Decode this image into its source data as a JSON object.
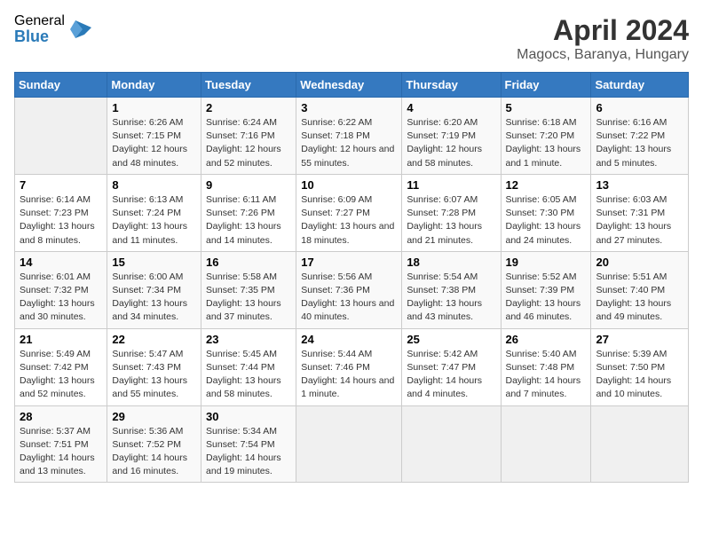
{
  "header": {
    "logo_general": "General",
    "logo_blue": "Blue",
    "month_year": "April 2024",
    "location": "Magocs, Baranya, Hungary"
  },
  "days_of_week": [
    "Sunday",
    "Monday",
    "Tuesday",
    "Wednesday",
    "Thursday",
    "Friday",
    "Saturday"
  ],
  "weeks": [
    [
      {
        "day": "",
        "sunrise": "",
        "sunset": "",
        "daylight": ""
      },
      {
        "day": "1",
        "sunrise": "Sunrise: 6:26 AM",
        "sunset": "Sunset: 7:15 PM",
        "daylight": "Daylight: 12 hours and 48 minutes."
      },
      {
        "day": "2",
        "sunrise": "Sunrise: 6:24 AM",
        "sunset": "Sunset: 7:16 PM",
        "daylight": "Daylight: 12 hours and 52 minutes."
      },
      {
        "day": "3",
        "sunrise": "Sunrise: 6:22 AM",
        "sunset": "Sunset: 7:18 PM",
        "daylight": "Daylight: 12 hours and 55 minutes."
      },
      {
        "day": "4",
        "sunrise": "Sunrise: 6:20 AM",
        "sunset": "Sunset: 7:19 PM",
        "daylight": "Daylight: 12 hours and 58 minutes."
      },
      {
        "day": "5",
        "sunrise": "Sunrise: 6:18 AM",
        "sunset": "Sunset: 7:20 PM",
        "daylight": "Daylight: 13 hours and 1 minute."
      },
      {
        "day": "6",
        "sunrise": "Sunrise: 6:16 AM",
        "sunset": "Sunset: 7:22 PM",
        "daylight": "Daylight: 13 hours and 5 minutes."
      }
    ],
    [
      {
        "day": "7",
        "sunrise": "Sunrise: 6:14 AM",
        "sunset": "Sunset: 7:23 PM",
        "daylight": "Daylight: 13 hours and 8 minutes."
      },
      {
        "day": "8",
        "sunrise": "Sunrise: 6:13 AM",
        "sunset": "Sunset: 7:24 PM",
        "daylight": "Daylight: 13 hours and 11 minutes."
      },
      {
        "day": "9",
        "sunrise": "Sunrise: 6:11 AM",
        "sunset": "Sunset: 7:26 PM",
        "daylight": "Daylight: 13 hours and 14 minutes."
      },
      {
        "day": "10",
        "sunrise": "Sunrise: 6:09 AM",
        "sunset": "Sunset: 7:27 PM",
        "daylight": "Daylight: 13 hours and 18 minutes."
      },
      {
        "day": "11",
        "sunrise": "Sunrise: 6:07 AM",
        "sunset": "Sunset: 7:28 PM",
        "daylight": "Daylight: 13 hours and 21 minutes."
      },
      {
        "day": "12",
        "sunrise": "Sunrise: 6:05 AM",
        "sunset": "Sunset: 7:30 PM",
        "daylight": "Daylight: 13 hours and 24 minutes."
      },
      {
        "day": "13",
        "sunrise": "Sunrise: 6:03 AM",
        "sunset": "Sunset: 7:31 PM",
        "daylight": "Daylight: 13 hours and 27 minutes."
      }
    ],
    [
      {
        "day": "14",
        "sunrise": "Sunrise: 6:01 AM",
        "sunset": "Sunset: 7:32 PM",
        "daylight": "Daylight: 13 hours and 30 minutes."
      },
      {
        "day": "15",
        "sunrise": "Sunrise: 6:00 AM",
        "sunset": "Sunset: 7:34 PM",
        "daylight": "Daylight: 13 hours and 34 minutes."
      },
      {
        "day": "16",
        "sunrise": "Sunrise: 5:58 AM",
        "sunset": "Sunset: 7:35 PM",
        "daylight": "Daylight: 13 hours and 37 minutes."
      },
      {
        "day": "17",
        "sunrise": "Sunrise: 5:56 AM",
        "sunset": "Sunset: 7:36 PM",
        "daylight": "Daylight: 13 hours and 40 minutes."
      },
      {
        "day": "18",
        "sunrise": "Sunrise: 5:54 AM",
        "sunset": "Sunset: 7:38 PM",
        "daylight": "Daylight: 13 hours and 43 minutes."
      },
      {
        "day": "19",
        "sunrise": "Sunrise: 5:52 AM",
        "sunset": "Sunset: 7:39 PM",
        "daylight": "Daylight: 13 hours and 46 minutes."
      },
      {
        "day": "20",
        "sunrise": "Sunrise: 5:51 AM",
        "sunset": "Sunset: 7:40 PM",
        "daylight": "Daylight: 13 hours and 49 minutes."
      }
    ],
    [
      {
        "day": "21",
        "sunrise": "Sunrise: 5:49 AM",
        "sunset": "Sunset: 7:42 PM",
        "daylight": "Daylight: 13 hours and 52 minutes."
      },
      {
        "day": "22",
        "sunrise": "Sunrise: 5:47 AM",
        "sunset": "Sunset: 7:43 PM",
        "daylight": "Daylight: 13 hours and 55 minutes."
      },
      {
        "day": "23",
        "sunrise": "Sunrise: 5:45 AM",
        "sunset": "Sunset: 7:44 PM",
        "daylight": "Daylight: 13 hours and 58 minutes."
      },
      {
        "day": "24",
        "sunrise": "Sunrise: 5:44 AM",
        "sunset": "Sunset: 7:46 PM",
        "daylight": "Daylight: 14 hours and 1 minute."
      },
      {
        "day": "25",
        "sunrise": "Sunrise: 5:42 AM",
        "sunset": "Sunset: 7:47 PM",
        "daylight": "Daylight: 14 hours and 4 minutes."
      },
      {
        "day": "26",
        "sunrise": "Sunrise: 5:40 AM",
        "sunset": "Sunset: 7:48 PM",
        "daylight": "Daylight: 14 hours and 7 minutes."
      },
      {
        "day": "27",
        "sunrise": "Sunrise: 5:39 AM",
        "sunset": "Sunset: 7:50 PM",
        "daylight": "Daylight: 14 hours and 10 minutes."
      }
    ],
    [
      {
        "day": "28",
        "sunrise": "Sunrise: 5:37 AM",
        "sunset": "Sunset: 7:51 PM",
        "daylight": "Daylight: 14 hours and 13 minutes."
      },
      {
        "day": "29",
        "sunrise": "Sunrise: 5:36 AM",
        "sunset": "Sunset: 7:52 PM",
        "daylight": "Daylight: 14 hours and 16 minutes."
      },
      {
        "day": "30",
        "sunrise": "Sunrise: 5:34 AM",
        "sunset": "Sunset: 7:54 PM",
        "daylight": "Daylight: 14 hours and 19 minutes."
      },
      {
        "day": "",
        "sunrise": "",
        "sunset": "",
        "daylight": ""
      },
      {
        "day": "",
        "sunrise": "",
        "sunset": "",
        "daylight": ""
      },
      {
        "day": "",
        "sunrise": "",
        "sunset": "",
        "daylight": ""
      },
      {
        "day": "",
        "sunrise": "",
        "sunset": "",
        "daylight": ""
      }
    ]
  ]
}
